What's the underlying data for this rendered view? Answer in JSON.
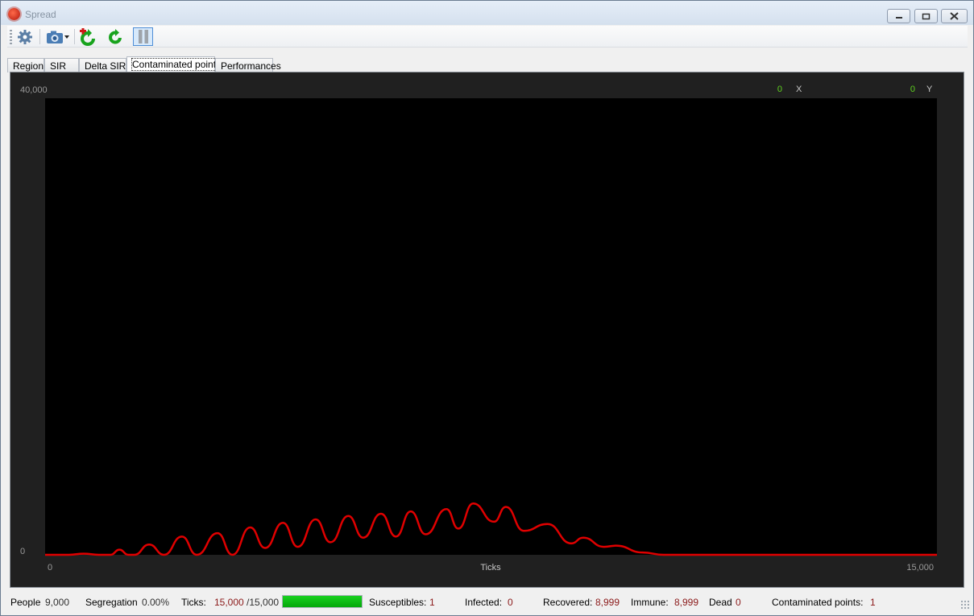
{
  "window": {
    "title": "Spread"
  },
  "tabs": [
    {
      "label": "Region"
    },
    {
      "label": "SIR"
    },
    {
      "label": "Delta SIR"
    },
    {
      "label": "Contaminated points",
      "selected": true
    },
    {
      "label": "Performances"
    }
  ],
  "toolbar": {
    "icons": [
      "gear-icon",
      "camera-icon",
      "dropdown-arrow-icon",
      "restart-add-icon",
      "refresh-icon",
      "pause-icon"
    ]
  },
  "cursor_readout": {
    "x_value": "0",
    "x_label": "X",
    "y_value": "0",
    "y_label": "Y"
  },
  "chart_data": {
    "type": "line",
    "xlabel": "Ticks",
    "x_tick_labels": [
      "0",
      "15,000"
    ],
    "y_tick_labels": [
      "40,000",
      "0"
    ],
    "xlim": [
      0,
      15000
    ],
    "ylim": [
      0,
      40000
    ],
    "grid": false,
    "background": "#000000",
    "series": [
      {
        "color": "#e00000",
        "points": [
          [
            0,
            0
          ],
          [
            400,
            0
          ],
          [
            650,
            100
          ],
          [
            900,
            0
          ],
          [
            1100,
            0
          ],
          [
            1250,
            450
          ],
          [
            1400,
            0
          ],
          [
            1500,
            0
          ],
          [
            1750,
            900
          ],
          [
            2000,
            0
          ],
          [
            2300,
            1600
          ],
          [
            2550,
            0
          ],
          [
            2900,
            1900
          ],
          [
            3150,
            0
          ],
          [
            3450,
            2400
          ],
          [
            3700,
            600
          ],
          [
            4000,
            2800
          ],
          [
            4250,
            700
          ],
          [
            4550,
            3100
          ],
          [
            4800,
            1100
          ],
          [
            5100,
            3400
          ],
          [
            5350,
            1500
          ],
          [
            5650,
            3600
          ],
          [
            5900,
            1600
          ],
          [
            6150,
            3800
          ],
          [
            6400,
            1800
          ],
          [
            6750,
            4000
          ],
          [
            6950,
            2300
          ],
          [
            7200,
            4500
          ],
          [
            7550,
            2900
          ],
          [
            7750,
            4200
          ],
          [
            8050,
            2100
          ],
          [
            8450,
            2700
          ],
          [
            8850,
            1000
          ],
          [
            9050,
            1500
          ],
          [
            9400,
            700
          ],
          [
            9600,
            800
          ],
          [
            10050,
            200
          ],
          [
            10400,
            0
          ],
          [
            15000,
            0
          ]
        ]
      }
    ]
  },
  "status": {
    "people_label": "People",
    "people_value": "9,000",
    "segregation_label": "Segregation",
    "segregation_value": "0.00%",
    "ticks_label": "Ticks:",
    "ticks_value": "15,000",
    "ticks_max": "/15,000",
    "progress": 1.0,
    "susceptibles_label": "Susceptibles:",
    "susceptibles_value": "1",
    "infected_label": "Infected:",
    "infected_value": "0",
    "recovered_label": "Recovered:",
    "recovered_value": "8,999",
    "immune_label": "Immune:",
    "immune_value": "8,999",
    "dead_label": "Dead",
    "dead_value": "0",
    "contaminated_label": "Contaminated points:",
    "contaminated_value": "1"
  }
}
